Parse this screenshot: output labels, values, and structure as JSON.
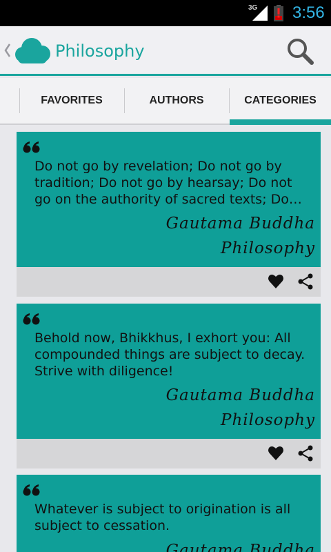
{
  "status_bar": {
    "network": "3G",
    "time": "3:56",
    "signal_icon": "signal-icon",
    "battery_icon": "battery-alert-icon",
    "clock_color": "#33b5e5"
  },
  "action_bar": {
    "title": "Philosophy",
    "back_icon": "chevron-left-icon",
    "app_icon": "cloud-icon",
    "search_icon": "search-icon",
    "accent_color": "#1aa59e"
  },
  "tabs": [
    {
      "label": "FAVORITES",
      "selected": false
    },
    {
      "label": "AUTHORS",
      "selected": false
    },
    {
      "label": "CATEGORIES",
      "selected": true
    }
  ],
  "quotes": [
    {
      "text": "Do not go by revelation; Do not go by tradition; Do not go by hearsay; Do not go on the authority of sacred texts; Do…",
      "author": "Gautama Buddha",
      "category": "Philosophy"
    },
    {
      "text": "Behold now, Bhikkhus, I exhort you: All compounded things are subject to decay. Strive with diligence!",
      "author": "Gautama Buddha",
      "category": "Philosophy"
    },
    {
      "text": "Whatever is subject to origination is all subject to cessation.",
      "author": "Gautama Buddha",
      "category": ""
    }
  ],
  "card_icons": {
    "favorite": "heart-icon",
    "share": "share-icon"
  },
  "colors": {
    "card": "#0f9f98",
    "card_footer": "#d6d6d8"
  }
}
